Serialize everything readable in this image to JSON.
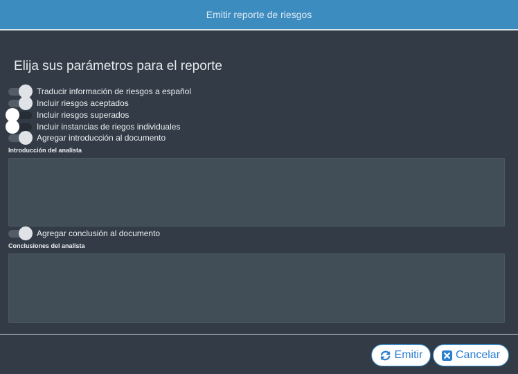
{
  "header": {
    "title": "Emitir reporte de riesgos"
  },
  "section": {
    "title": "Elija sus parámetros para el reporte"
  },
  "options": [
    {
      "label": "Traducir información de riesgos a español",
      "checked": true
    },
    {
      "label": "Incluir riesgos aceptados",
      "checked": true
    },
    {
      "label": "Incluir riesgos superados",
      "checked": false
    },
    {
      "label": "Incluir instancias de riegos individuales",
      "checked": false
    },
    {
      "label": "Agregar introducción al documento",
      "checked": true
    }
  ],
  "intro": {
    "label": "Introducción del analista",
    "value": ""
  },
  "conclusion_toggle": {
    "label": "Agregar conclusión al documento",
    "checked": true
  },
  "conclusion": {
    "label": "Conclusiones del analista",
    "value": ""
  },
  "buttons": {
    "emit": {
      "label": "Emitir",
      "icon": "refresh-icon"
    },
    "cancel": {
      "label": "Cancelar",
      "icon": "close-box-icon"
    }
  },
  "colors": {
    "header": "#3d8cc0",
    "background": "#323b46",
    "button_text": "#2b7fd0"
  }
}
